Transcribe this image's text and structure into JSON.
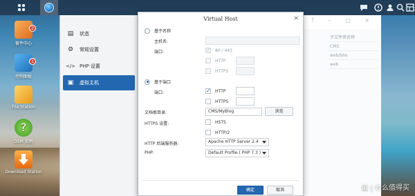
{
  "taskbar": {
    "left_icons": [
      "main-menu-icon",
      "web-station-icon"
    ],
    "right_icons": [
      "chat-icon",
      "notification-icon",
      "user-icon",
      "search-icon",
      "widgets-icon"
    ]
  },
  "desktop": {
    "icons": [
      {
        "name": "package-center",
        "label": "套件中心",
        "badge": "2",
        "color": "#e88a2a"
      },
      {
        "name": "control-panel",
        "label": "控制面板",
        "badge": "1",
        "color": "#2d8bd6"
      },
      {
        "name": "file-station",
        "label": "File Station",
        "badge": "",
        "color": "#f2b233"
      },
      {
        "name": "dsm-help",
        "label": "DSM 说明",
        "badge": "",
        "color": "#6cbf3f"
      },
      {
        "name": "download-station",
        "label": "Download Station",
        "badge": "",
        "color": "#f08a1c"
      }
    ]
  },
  "background_window": {
    "sidebar": [
      {
        "label": "状态",
        "icon": "status-icon",
        "active": false
      },
      {
        "label": "常规设置",
        "icon": "gear-icon",
        "active": false
      },
      {
        "label": "PHP 设置",
        "icon": "code-icon",
        "active": false
      },
      {
        "label": "虚拟主机",
        "icon": "virtual-host-icon",
        "active": true
      }
    ],
    "column_header": "子文件夹名称",
    "column_values": [
      "CMS",
      "web/bbs",
      "web"
    ],
    "window_controls": "? – □ ×"
  },
  "dialog": {
    "title": "Virtual Host",
    "close_glyph": "×",
    "name_based": {
      "label": "基于名称",
      "selected": false,
      "hostname_label": "主机名:",
      "hostname_value": "",
      "port_label": "端口:",
      "ports": [
        {
          "label": "80 / 443",
          "checked": true
        },
        {
          "label": "HTTP",
          "checked": false
        },
        {
          "label": "HTTPS",
          "checked": false
        }
      ]
    },
    "port_based": {
      "label": "基于端口",
      "selected": true,
      "port_label": "端口:",
      "ports": [
        {
          "label": "HTTP",
          "checked": true
        },
        {
          "label": "HTTPS",
          "checked": false
        }
      ]
    },
    "doc_root": {
      "label": "文档根目录:",
      "value": "CMS/MyBlog",
      "browse_label": "浏览"
    },
    "https_settings": {
      "label": "HTTPS 设置:",
      "options": [
        {
          "label": "HSTS",
          "checked": false
        },
        {
          "label": "HTTP/2",
          "checked": false
        }
      ]
    },
    "http_backend": {
      "label": "HTTP 后端服务器:",
      "value": "Apache HTTP Server 2.4"
    },
    "php": {
      "label": "PHP:",
      "value": "Default Profile ( PHP 7.3 )"
    },
    "ok_label": "确定",
    "cancel_label": "取消"
  },
  "watermark": "值 | 什么值得买"
}
